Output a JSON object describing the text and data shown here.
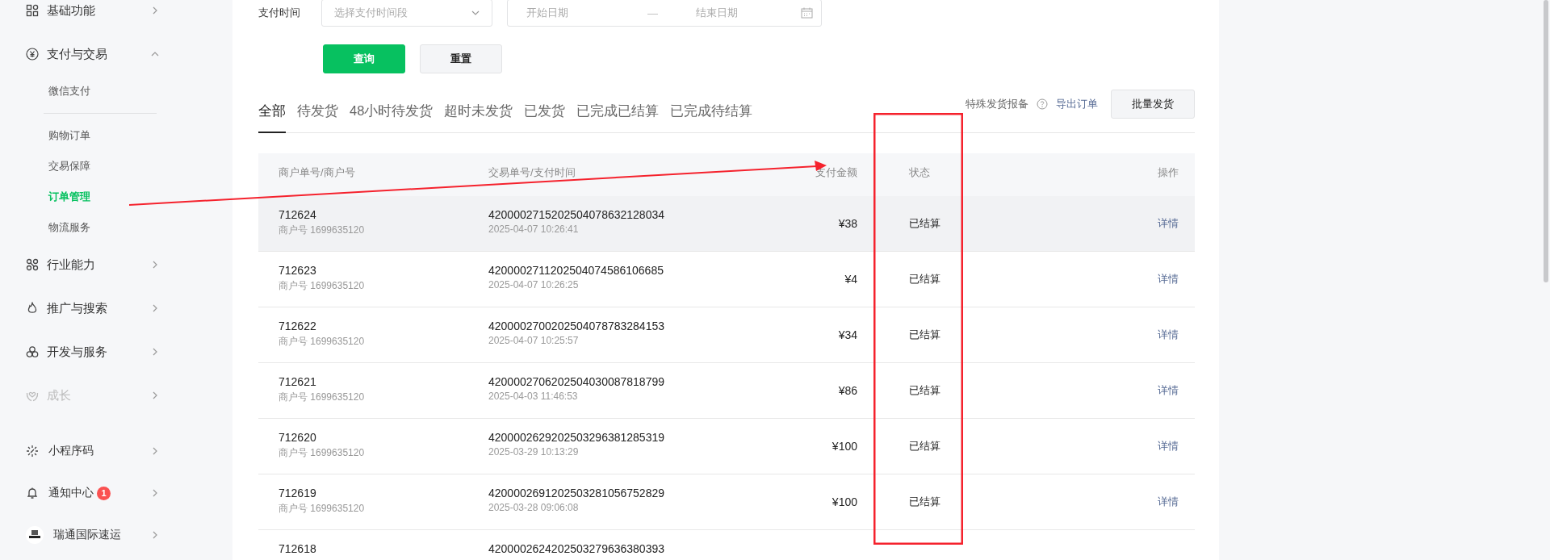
{
  "sidebar": {
    "groups": [
      {
        "label": "基础功能",
        "expanded": false,
        "disabled": false
      },
      {
        "label": "支付与交易",
        "expanded": true,
        "disabled": false,
        "sections": [
          [
            {
              "label": "微信支付",
              "selected": false
            }
          ],
          [
            {
              "label": "购物订单",
              "selected": false
            },
            {
              "label": "交易保障",
              "selected": false
            },
            {
              "label": "订单管理",
              "selected": true
            },
            {
              "label": "物流服务",
              "selected": false
            }
          ]
        ]
      },
      {
        "label": "行业能力",
        "expanded": false,
        "disabled": false
      },
      {
        "label": "推广与搜索",
        "expanded": false,
        "disabled": false
      },
      {
        "label": "开发与服务",
        "expanded": false,
        "disabled": false
      },
      {
        "label": "成长",
        "expanded": false,
        "disabled": true
      }
    ],
    "footer_items": [
      {
        "kind": "icon",
        "label": "小程序码"
      },
      {
        "kind": "icon",
        "label": "通知中心",
        "badge": "1"
      },
      {
        "kind": "avatar",
        "label": "瑞通国际速运"
      }
    ]
  },
  "filter": {
    "label": "支付时间",
    "period": {
      "placeholder": "选择支付时间段"
    },
    "date_range": {
      "start_placeholder": "开始日期",
      "separator": "—",
      "end_placeholder": "结束日期"
    },
    "buttons": [
      {
        "label": "查询",
        "kind": "primary"
      },
      {
        "label": "重置",
        "kind": "default"
      }
    ]
  },
  "tabs": [
    {
      "label": "全部",
      "selected": true
    },
    {
      "label": "待发货",
      "selected": false
    },
    {
      "label": "48小时待发货",
      "selected": false
    },
    {
      "label": "超时未发货",
      "selected": false
    },
    {
      "label": "已发货",
      "selected": false
    },
    {
      "label": "已完成已结算",
      "selected": false
    },
    {
      "label": "已完成待结算",
      "selected": false
    }
  ],
  "toolbar": {
    "report_link": "特殊发货报备",
    "export_link": "导出订单",
    "batch_button": "批量发货"
  },
  "table": {
    "columns": [
      "商户单号/商户号",
      "交易单号/支付时间",
      "支付金额",
      "状态",
      "操作"
    ],
    "rows": [
      {
        "order_no": "712624",
        "merchant": "商户号 1699635120",
        "transaction_no": "4200002715202504078632128034",
        "pay_time": "2025-04-07 10:26:41",
        "amount": "¥38",
        "status": "已结算",
        "action": "详情",
        "hovered": true
      },
      {
        "order_no": "712623",
        "merchant": "商户号 1699635120",
        "transaction_no": "4200002711202504074586106685",
        "pay_time": "2025-04-07 10:26:25",
        "amount": "¥4",
        "status": "已结算",
        "action": "详情",
        "hovered": false
      },
      {
        "order_no": "712622",
        "merchant": "商户号 1699635120",
        "transaction_no": "4200002700202504078783284153",
        "pay_time": "2025-04-07 10:25:57",
        "amount": "¥34",
        "status": "已结算",
        "action": "详情",
        "hovered": false
      },
      {
        "order_no": "712621",
        "merchant": "商户号 1699635120",
        "transaction_no": "4200002706202504030087818799",
        "pay_time": "2025-04-03 11:46:53",
        "amount": "¥86",
        "status": "已结算",
        "action": "详情",
        "hovered": false
      },
      {
        "order_no": "712620",
        "merchant": "商户号 1699635120",
        "transaction_no": "4200002629202503296381285319",
        "pay_time": "2025-03-29 10:13:29",
        "amount": "¥100",
        "status": "已结算",
        "action": "详情",
        "hovered": false
      },
      {
        "order_no": "712619",
        "merchant": "商户号 1699635120",
        "transaction_no": "4200002691202503281056752829",
        "pay_time": "2025-03-28 09:06:08",
        "amount": "¥100",
        "status": "已结算",
        "action": "详情",
        "hovered": false
      },
      {
        "order_no": "712618",
        "transaction_no": "4200002624202503279636380393",
        "hovered": false
      }
    ]
  }
}
